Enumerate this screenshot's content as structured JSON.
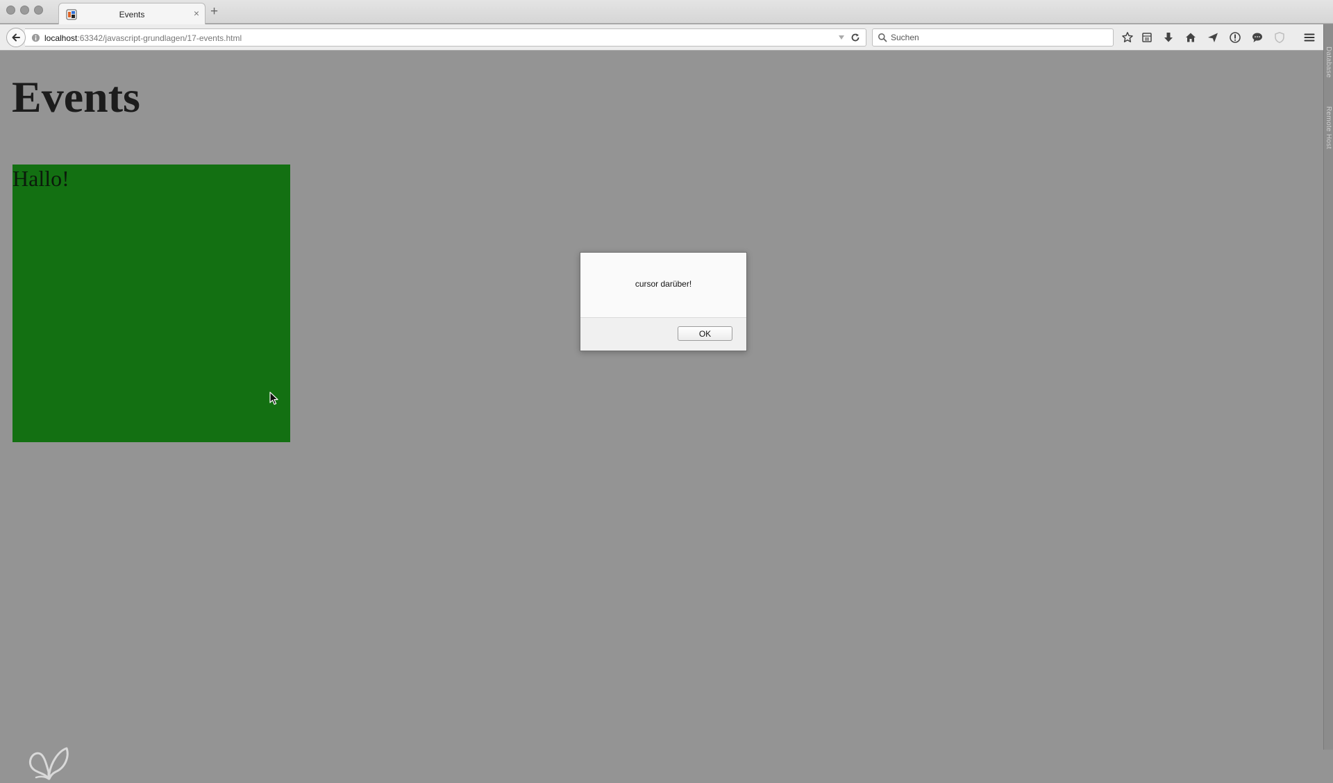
{
  "browser": {
    "tab": {
      "title": "Events",
      "close_glyph": "×",
      "favicon": "page-favicon"
    },
    "new_tab_glyph": "+",
    "url": {
      "host": "localhost",
      "path": ":63342/javascript-grundlagen/17-events.html"
    },
    "search": {
      "placeholder": "Suchen"
    },
    "toolbar_icons": [
      "bookmark-star-icon",
      "reading-list-icon",
      "download-icon",
      "home-icon",
      "pocket-send-icon",
      "info-icon",
      "chat-icon",
      "shield-icon",
      "hamburger-menu-icon"
    ],
    "side_panel_labels": [
      "Database",
      "Remote Host"
    ]
  },
  "page": {
    "heading": "Events",
    "box_text": "Hallo!",
    "box_color": "#137012",
    "background_color": "#949494"
  },
  "alert": {
    "message": "cursor darüber!",
    "ok_label": "OK"
  }
}
